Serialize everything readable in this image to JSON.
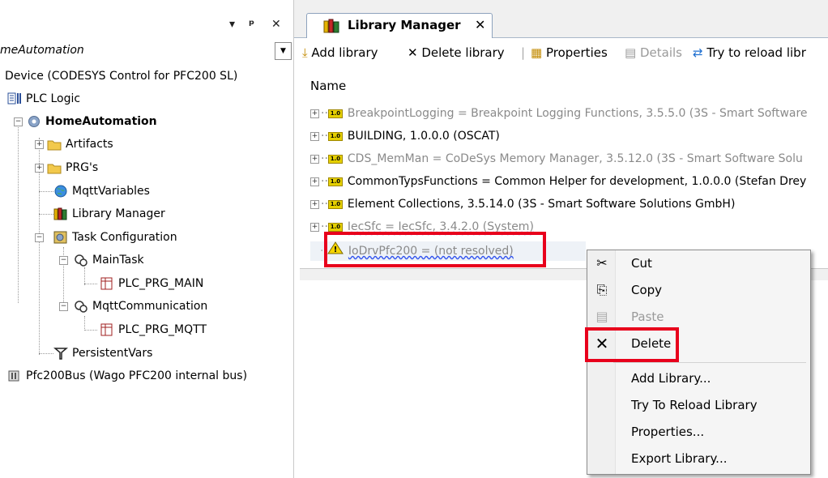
{
  "left_panel": {
    "panel_controls": {
      "dropdown": "▾",
      "pin": "ᵖ",
      "close": "✕"
    },
    "combo_text": "meAutomation",
    "tree": [
      {
        "key": "device",
        "label": "Device (CODESYS Control for PFC200 SL)"
      },
      {
        "key": "plc_logic",
        "label": "PLC Logic"
      },
      {
        "key": "app",
        "label": "HomeAutomation"
      },
      {
        "key": "artifacts",
        "label": "Artifacts"
      },
      {
        "key": "prgs",
        "label": "PRG's"
      },
      {
        "key": "mqtt_vars",
        "label": "MqttVariables"
      },
      {
        "key": "lib_mgr",
        "label": "Library Manager"
      },
      {
        "key": "task_cfg",
        "label": "Task Configuration"
      },
      {
        "key": "main_task",
        "label": "MainTask"
      },
      {
        "key": "plc_prg_main",
        "label": "PLC_PRG_MAIN"
      },
      {
        "key": "mqtt_comm",
        "label": "MqttCommunication"
      },
      {
        "key": "plc_prg_mqtt",
        "label": "PLC_PRG_MQTT"
      },
      {
        "key": "persistent",
        "label": "PersistentVars"
      },
      {
        "key": "pfc_bus",
        "label": "Pfc200Bus (Wago PFC200 internal bus)"
      }
    ]
  },
  "editor": {
    "tab_label": "Library Manager",
    "tab_close": "✕",
    "toolbar": {
      "add_library": "Add library",
      "delete_library": "Delete library",
      "properties": "Properties",
      "details": "Details",
      "try_reload": "Try to reload libr"
    },
    "column_header": "Name",
    "libraries": [
      {
        "label": "BreakpointLogging = Breakpoint Logging Functions, 3.5.5.0 (3S - Smart Software",
        "state": "gray"
      },
      {
        "label": "BUILDING, 1.0.0.0 (OSCAT)",
        "state": "normal"
      },
      {
        "label": "CDS_MemMan = CoDeSys Memory Manager, 3.5.12.0 (3S - Smart Software Solu",
        "state": "gray"
      },
      {
        "label": "CommonTypsFunctions = Common Helper for development, 1.0.0.0 (Stefan Drey",
        "state": "normal"
      },
      {
        "label": "Element Collections, 3.5.14.0 (3S - Smart Software Solutions GmbH)",
        "state": "normal"
      },
      {
        "label": "IecSfc = IecSfc, 3.4.2.0 (System)",
        "state": "gray"
      },
      {
        "label": "IoDrvPfc200 = (not resolved)",
        "state": "unresolved"
      }
    ],
    "version_badge": "1.0"
  },
  "context_menu": {
    "items": [
      {
        "label": "Cut",
        "icon": "✂",
        "enabled": true
      },
      {
        "label": "Copy",
        "icon": "⎘",
        "enabled": true
      },
      {
        "label": "Paste",
        "icon": "📋",
        "enabled": false
      },
      {
        "label": "Delete",
        "icon": "✕",
        "enabled": true
      },
      {
        "label": "Add Library...",
        "enabled": true
      },
      {
        "label": "Try To Reload Library",
        "enabled": true
      },
      {
        "label": "Properties...",
        "enabled": true
      },
      {
        "label": "Export Library...",
        "enabled": true
      }
    ]
  },
  "colors": {
    "highlight_box": "#e8001c",
    "accent": "#8da2bd"
  }
}
